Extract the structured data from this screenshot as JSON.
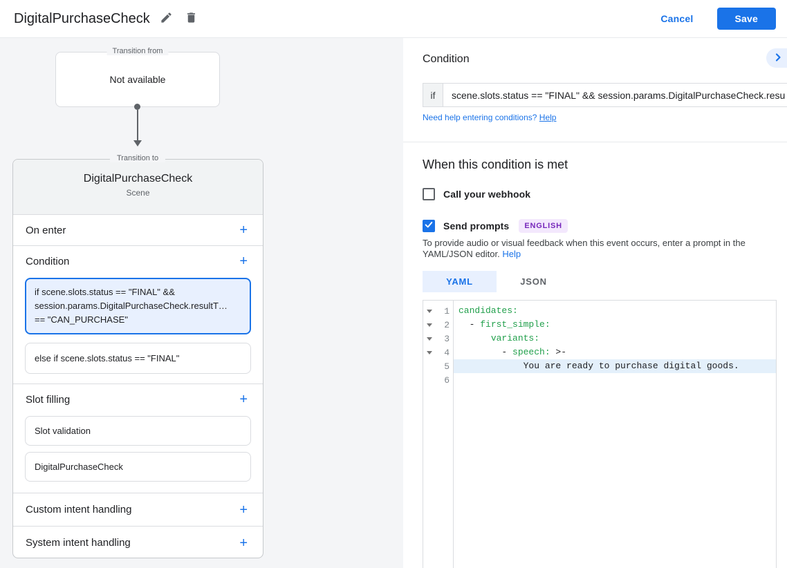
{
  "colors": {
    "accent_blue": "#1a73e8",
    "selected_item_bg": "#e8f0fe",
    "code_key_green": "#22a04c",
    "code_highlight_bg": "#e4f0fb",
    "badge_bg": "#f3e8fd",
    "badge_text": "#7627bb"
  },
  "header": {
    "title": "DigitalPurchaseCheck",
    "cancel_label": "Cancel",
    "save_label": "Save"
  },
  "diagram": {
    "from_label": "Transition from",
    "from_value": "Not available",
    "to_label": "Transition to"
  },
  "scene_card": {
    "title": "DigitalPurchaseCheck",
    "subtitle": "Scene",
    "add_symbol": "+",
    "on_enter_label": "On enter",
    "condition_label": "Condition",
    "condition_items": [
      {
        "lines": [
          "if scene.slots.status == \"FINAL\" &&",
          "session.params.DigitalPurchaseCheck.resultT…",
          "== \"CAN_PURCHASE\""
        ]
      },
      {
        "lines": [
          "else if scene.slots.status == \"FINAL\""
        ]
      }
    ],
    "slot_filling_label": "Slot filling",
    "slot_items": [
      "Slot validation",
      "DigitalPurchaseCheck"
    ],
    "custom_intent_label": "Custom intent handling",
    "system_intent_label": "System intent handling"
  },
  "condition_panel": {
    "title": "Condition",
    "if_label": "if",
    "if_value": "scene.slots.status == \"FINAL\" && session.params.DigitalPurchaseCheck.resu",
    "help_prompt": "Need help entering conditions? ",
    "help_link": "Help",
    "met_heading": "When this condition is met",
    "webhook_label": "Call your webhook",
    "prompts_label": "Send prompts",
    "language_badge": "ENGLISH",
    "prompts_help_text": "To provide audio or visual feedback when this event occurs, enter a prompt in the YAML/JSON editor. ",
    "prompts_help_link": "Help",
    "tab_yaml": "YAML",
    "tab_json": "JSON"
  },
  "editor": {
    "lines": [
      {
        "num": "1",
        "pre": "",
        "key": "candidates:",
        "post": ""
      },
      {
        "num": "2",
        "pre": "  - ",
        "key": "first_simple:",
        "post": ""
      },
      {
        "num": "3",
        "pre": "      ",
        "key": "variants:",
        "post": ""
      },
      {
        "num": "4",
        "pre": "        - ",
        "key": "speech:",
        "post": " >-"
      },
      {
        "num": "5",
        "pre": "            You are ready to purchase digital goods.",
        "key": "",
        "post": ""
      },
      {
        "num": "6",
        "pre": "",
        "key": "",
        "post": ""
      }
    ]
  }
}
